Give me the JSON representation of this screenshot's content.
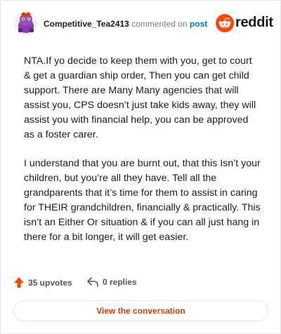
{
  "comment": {
    "author": "Competitive_Tea2413",
    "action_text": "commented on",
    "post_link": "post",
    "brand": "reddit",
    "paragraphs": [
      "NTA.If yo decide to keep them with you, get to court & get a guardian ship order, Then you can get child support. There are Many Many agencies that will assist you, CPS doesn’t just take kids away, they will assist you with financial help, you can be approved as a foster carer.",
      "I understand that you are burnt out, that this Isn’t your children, but you’re all they have. Tell all the grandparents that it’s time for them to assist in caring for THEIR grandchildren, financially & practically. This isn’t an Either Or situation & if you can all just hang in there for a bit longer, it will get easier."
    ],
    "upvotes_label": "35 upvotes",
    "replies_label": "0 replies",
    "cta_label": "View the conversation"
  },
  "colors": {
    "brand_orange": "#ff4500",
    "link_blue": "#0079d3",
    "cta_orange": "#d93a00",
    "avatar_purple": "#8a3ea8"
  },
  "icons": [
    "snoo-avatar-icon",
    "reddit-logo-icon",
    "upvote-arrow-icon",
    "reply-arrow-icon"
  ]
}
